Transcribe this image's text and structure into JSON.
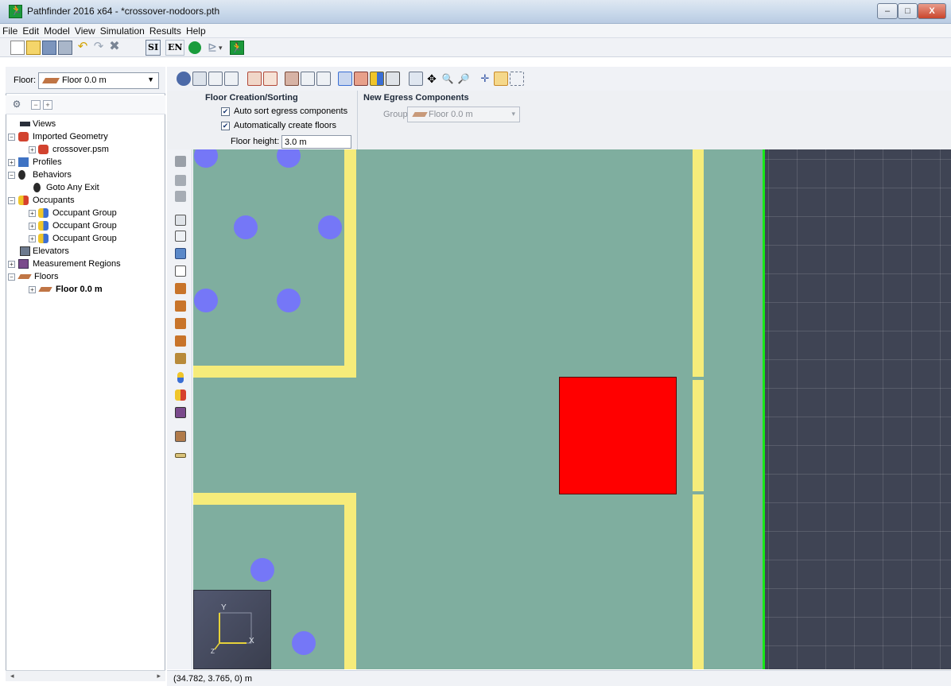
{
  "window": {
    "title": "Pathfinder 2016 x64 - *crossover-nodoors.pth",
    "controls": [
      "–",
      "□",
      "X"
    ]
  },
  "menu": [
    "File",
    "Edit",
    "Model",
    "View",
    "Simulation",
    "Results",
    "Help"
  ],
  "toolbar": {
    "unit_si": "SI",
    "unit_en": "EN"
  },
  "floor_selector": {
    "label": "Floor:",
    "value": "Floor 0.0 m"
  },
  "tree": {
    "items": [
      {
        "label": "Views",
        "icon": "views-icon"
      },
      {
        "label": "Imported Geometry",
        "icon": "geometry-icon"
      },
      {
        "label": "crossover.psm",
        "icon": "geometry-icon"
      },
      {
        "label": "Profiles",
        "icon": "profiles-icon"
      },
      {
        "label": "Behaviors",
        "icon": "behaviors-icon"
      },
      {
        "label": "Goto Any Exit",
        "icon": "behaviors-icon"
      },
      {
        "label": "Occupants",
        "icon": "occupants-icon"
      },
      {
        "label": "Occupant Group",
        "icon": "occupants-icon"
      },
      {
        "label": "Occupant Group",
        "icon": "occupants-icon"
      },
      {
        "label": "Occupant Group",
        "icon": "occupants-icon"
      },
      {
        "label": "Elevators",
        "icon": "elevator-icon"
      },
      {
        "label": "Measurement Regions",
        "icon": "measurement-region-icon"
      },
      {
        "label": "Floors",
        "icon": "floor-icon"
      },
      {
        "label": "Floor 0.0 m",
        "icon": "floor-icon"
      }
    ]
  },
  "properties": {
    "floor_creation": {
      "title": "Floor Creation/Sorting",
      "auto_sort_label": "Auto sort egress components",
      "auto_sort_checked": true,
      "auto_create_label": "Automatically create floors",
      "auto_create_checked": true,
      "floor_height_label": "Floor height:",
      "floor_height_value": "3.0 m"
    },
    "new_egress": {
      "title": "New Egress Components",
      "group_label": "Group:",
      "group_value": "Floor 0.0 m"
    }
  },
  "axis_indicator": {
    "x_label": "X",
    "y_label": "Y",
    "z_label": "Z"
  },
  "status": {
    "coordinates": "(34.782, 3.765, 0) m"
  },
  "colors": {
    "floor": "#7fae9f",
    "walls": "#f6ec7a",
    "occupants": "#7577f7",
    "obstruction": "#ff0000",
    "exit": "#18e818",
    "background_grid": "#3f4454"
  }
}
